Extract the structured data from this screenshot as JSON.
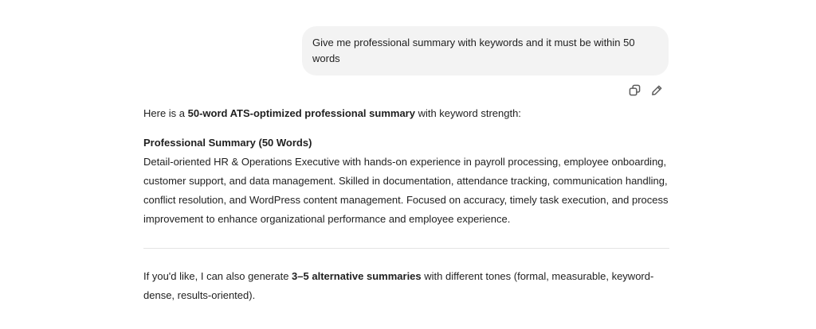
{
  "user_message": {
    "text": "Give me professional summary with keywords and it must be within 50 words"
  },
  "message_actions": {
    "copy_icon": "copy-icon",
    "edit_icon": "pencil-icon"
  },
  "assistant_message": {
    "intro_prefix": "Here is a ",
    "intro_bold": "50-word ATS-optimized professional summary",
    "intro_suffix": " with keyword strength:",
    "summary_heading": "Professional Summary (50 Words)",
    "summary_text": "Detail-oriented HR & Operations Executive with hands-on experience in payroll processing, employee onboarding, customer support, and data management. Skilled in documentation, attendance tracking, communication handling, conflict resolution, and WordPress content management. Focused on accuracy, timely task execution, and process improvement to enhance organizational performance and employee experience.",
    "outro_prefix": "If you'd like, I can also generate ",
    "outro_bold": "3–5 alternative summaries",
    "outro_suffix": " with different tones (formal, measurable, keyword-dense, results-oriented)."
  },
  "colors": {
    "user_bubble_bg": "#f3f3f3",
    "text": "#1f1f1f",
    "icon": "#5d5d5d",
    "divider": "#e5e5e5"
  }
}
